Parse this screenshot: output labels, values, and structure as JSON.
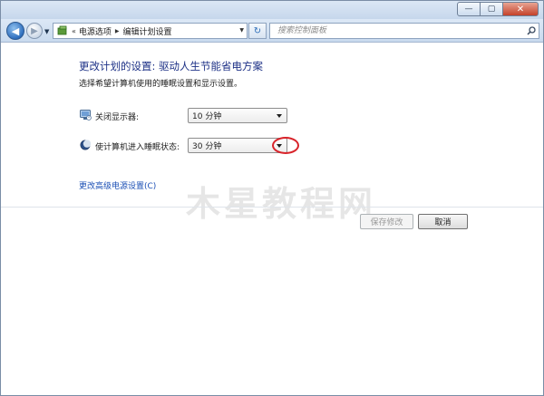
{
  "window": {
    "minimize_glyph": "—",
    "maximize_glyph": "▢",
    "close_glyph": "✕"
  },
  "nav": {
    "back_glyph": "◀",
    "forward_glyph": "▶",
    "history_glyph": "▼",
    "address": {
      "overflow": "«",
      "crumbs": [
        "电源选项",
        "编辑计划设置"
      ],
      "separator_glyph": "▶",
      "dropdown_glyph": "▼"
    },
    "refresh_glyph": "↻",
    "search_placeholder": "搜索控制面板"
  },
  "content": {
    "title": "更改计划的设置: 驱动人生节能省电方案",
    "subtitle": "选择希望计算机使用的睡眠设置和显示设置。",
    "display_off": {
      "label": "关闭显示器:",
      "value": "10 分钟"
    },
    "sleep": {
      "label": "使计算机进入睡眠状态:",
      "value": "30 分钟"
    },
    "advanced_link": "更改高级电源设置(C)",
    "save_button": "保存修改",
    "cancel_button": "取消"
  },
  "watermark": "木星教程网",
  "colors": {
    "title": "#1e3287",
    "link": "#1b4fb5",
    "highlight": "#d8232a"
  }
}
